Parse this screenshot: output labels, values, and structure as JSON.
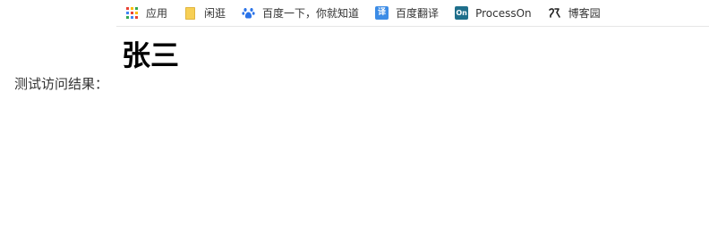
{
  "bookmarks": [
    {
      "label": "应用",
      "icon": "apps-grid-icon"
    },
    {
      "label": "闲逛",
      "icon": "folder-icon"
    },
    {
      "label": "百度一下，你就知道",
      "icon": "baidu-paw-icon"
    },
    {
      "label": "百度翻译",
      "icon": "baidu-translate-icon",
      "icon_text": "译"
    },
    {
      "label": "ProcessOn",
      "icon": "processon-icon",
      "icon_text": "On"
    },
    {
      "label": "博客园",
      "icon": "cnblogs-icon"
    }
  ],
  "page": {
    "heading": "张三",
    "result_label": "测试访问结果："
  },
  "colors": {
    "translate_blue": "#3c8ce6",
    "processon_teal": "#1f6f8b",
    "baidu_blue": "#2a73e8"
  }
}
